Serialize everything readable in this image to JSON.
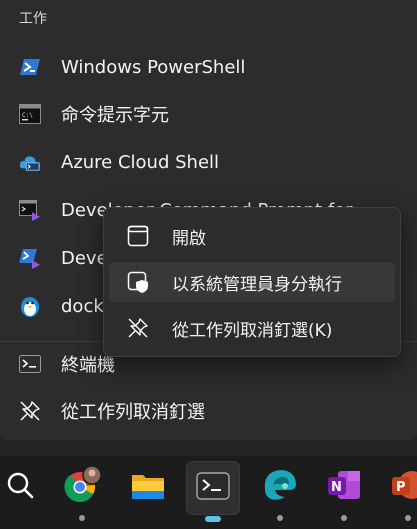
{
  "jumplist": {
    "section_title": "工作",
    "items": [
      {
        "label": "Windows PowerShell",
        "icon": "powershell-icon"
      },
      {
        "label": "命令提示字元",
        "icon": "command-prompt-icon"
      },
      {
        "label": "Azure Cloud Shell",
        "icon": "azure-cloud-shell-icon"
      },
      {
        "label": "Developer Command Prompt for",
        "icon": "developer-command-prompt-icon"
      },
      {
        "label": "Developer PowerShell",
        "icon": "developer-powershell-icon"
      },
      {
        "label": "docker",
        "icon": "docker-icon"
      }
    ],
    "app_label": "終端機",
    "unpin_label": "從工作列取消釘選"
  },
  "context_menu": {
    "items": [
      {
        "label": "開啟",
        "icon": "open-window-icon"
      },
      {
        "label": "以系統管理員身分執行",
        "icon": "run-as-admin-shield-icon"
      },
      {
        "label": "從工作列取消釘選(K)",
        "icon": "unpin-icon"
      }
    ]
  },
  "taskbar": {
    "apps": [
      "search-icon",
      "chrome-icon",
      "file-explorer-icon",
      "terminal-icon",
      "edge-icon",
      "onenote-icon",
      "powerpoint-icon"
    ],
    "active_app": "terminal-icon"
  },
  "colors": {
    "menu_bg": "#2c2c2c",
    "jumplist_bg": "#2c2c2c",
    "taskbar_bg": "#1c1c1c",
    "accent": "#5ec1e6",
    "text": "#f3f3f3"
  }
}
